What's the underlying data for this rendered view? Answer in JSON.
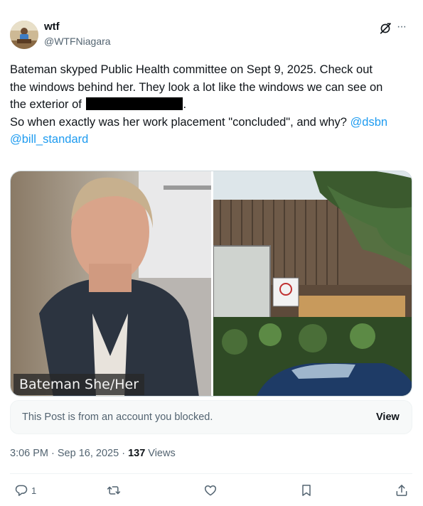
{
  "author": {
    "display_name": "wtf",
    "handle": "@WTFNiagara",
    "avatar_icon": "avatar-photo"
  },
  "header_icons": {
    "grok": "grok-icon",
    "more": "···"
  },
  "tweet": {
    "line1": "Bateman skyped Public Health committee on Sept 9, 2025. Check out",
    "line2": "the windows behind her. They look a lot like the windows we can see on",
    "line3_start": "the exterior of",
    "line3_end": ".",
    "line4_text": "So when exactly was her work placement \"concluded\", and why? ",
    "mention1": "@dsbn",
    "mention2": "@bill_standard"
  },
  "media": {
    "left_caption": "Bateman She/Her"
  },
  "blocked": {
    "text": "This Post is from an account you blocked.",
    "view_label": "View"
  },
  "meta": {
    "time": "3:06 PM",
    "sep1": " · ",
    "date": "Sep 16, 2025",
    "sep2": " · ",
    "views_count": "137",
    "views_label": " Views"
  },
  "actions": {
    "reply_count": "1"
  },
  "colors": {
    "accent": "#1d9bf0",
    "secondary_text": "#536471",
    "primary_text": "#0f1419"
  }
}
